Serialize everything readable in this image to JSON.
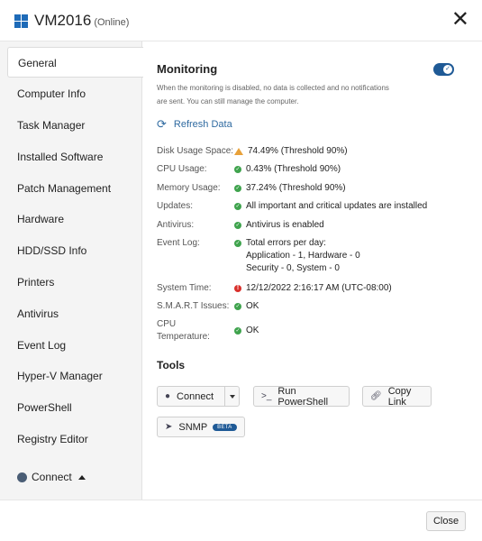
{
  "header": {
    "title": "VM2016",
    "status": "(Online)",
    "close_glyph": "✕"
  },
  "sidebar": {
    "items": [
      {
        "label": "General"
      },
      {
        "label": "Computer Info"
      },
      {
        "label": "Task Manager"
      },
      {
        "label": "Installed Software"
      },
      {
        "label": "Patch Management"
      },
      {
        "label": "Hardware"
      },
      {
        "label": "HDD/SSD Info"
      },
      {
        "label": "Printers"
      },
      {
        "label": "Antivirus"
      },
      {
        "label": "Event Log"
      },
      {
        "label": "Hyper-V Manager"
      },
      {
        "label": "PowerShell"
      },
      {
        "label": "Registry Editor"
      }
    ],
    "active": "General",
    "connect_label": "Connect"
  },
  "monitoring": {
    "title": "Monitoring",
    "description": "When the monitoring is disabled, no data is collected and no notifications are sent. You can still manage the computer.",
    "enabled": true
  },
  "refresh_label": "Refresh Data",
  "stats": {
    "disk": {
      "label": "Disk Usage Space:",
      "value": "74.49% (Threshold 90%)",
      "status": "warning"
    },
    "cpu": {
      "label": "CPU Usage:",
      "value": "0.43% (Threshold 90%)",
      "status": "ok"
    },
    "memory": {
      "label": "Memory Usage:",
      "value": "37.24% (Threshold 90%)",
      "status": "ok"
    },
    "updates": {
      "label": "Updates:",
      "value": "All important and critical updates are installed",
      "status": "ok"
    },
    "antivirus": {
      "label": "Antivirus:",
      "value": "Antivirus is enabled",
      "status": "ok"
    },
    "eventlog": {
      "label": "Event Log:",
      "line1": "Total errors per day:",
      "line2": "Application - 1, Hardware - 0",
      "line3": "Security - 0, System - 0",
      "status": "ok"
    },
    "systemtime": {
      "label": "System Time:",
      "value": "12/12/2022 2:16:17 AM (UTC-08:00)",
      "status": "error"
    },
    "smart": {
      "label": "S.M.A.R.T Issues:",
      "value": "OK",
      "status": "ok"
    },
    "cputemp": {
      "label_line1": "CPU",
      "label_line2": "Temperature:",
      "value": "OK",
      "status": "ok"
    }
  },
  "tools": {
    "title": "Tools",
    "connect": "Connect",
    "powershell": "Run PowerShell",
    "copylink": "Copy Link",
    "snmp": "SNMP",
    "snmp_badge": "BETA"
  },
  "footer": {
    "close_label": "Close"
  },
  "colors": {
    "accent": "#1f5a96",
    "ok": "#3fa34d",
    "warning": "#e8a13a",
    "error": "#d9302c",
    "link": "#2f6aa0"
  }
}
